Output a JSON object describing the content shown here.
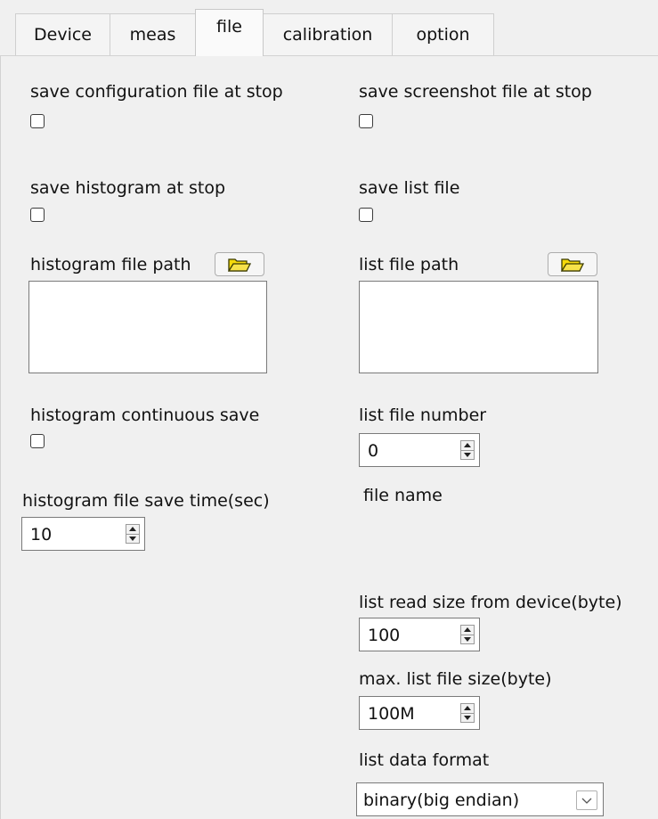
{
  "tabs": [
    {
      "label": "Device"
    },
    {
      "label": "meas"
    },
    {
      "label": "file"
    },
    {
      "label": "calibration"
    },
    {
      "label": "option"
    }
  ],
  "active_tab": "file",
  "left": {
    "save_config_label": "save configuration file at stop",
    "save_config_checked": false,
    "save_histogram_label": "save histogram at stop",
    "save_histogram_checked": false,
    "histogram_path_label": "histogram file path",
    "histogram_path_value": "",
    "continuous_save_label": "histogram continuous save",
    "continuous_save_checked": false,
    "save_time_label": "histogram file save time(sec)",
    "save_time_value": "10"
  },
  "right": {
    "save_screenshot_label": "save screenshot file at stop",
    "save_screenshot_checked": false,
    "save_list_label": "save list file",
    "save_list_checked": false,
    "list_path_label": "list file path",
    "list_path_value": "",
    "list_file_number_label": "list file number",
    "list_file_number_value": "0",
    "file_name_label": "file name",
    "read_size_label": "list read size from device(byte)",
    "read_size_value": "100",
    "max_size_label": "max. list file size(byte)",
    "max_size_value": "100M",
    "data_format_label": "list data format",
    "data_format_value": "binary(big endian)"
  },
  "icons": {
    "folder": "folder-open-icon",
    "spin": "spin-arrows-icon",
    "dropdown": "chevron-down-icon"
  },
  "colors": {
    "folder_fill": "#f5d90a",
    "folder_stroke": "#3a3a00"
  }
}
